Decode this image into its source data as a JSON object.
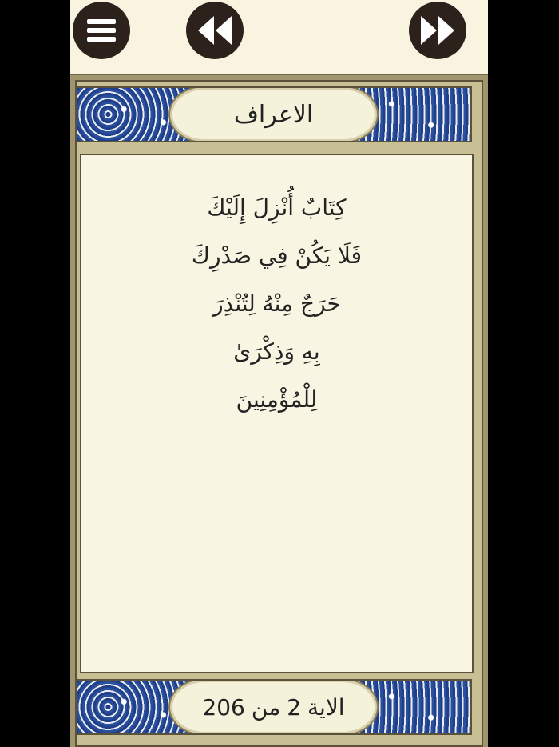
{
  "toolbar": {
    "menu_icon": "menu-icon",
    "prev_icon": "rewind-icon",
    "next_icon": "fast-forward-icon"
  },
  "header": {
    "surah_name": "الاعراف"
  },
  "verse": {
    "lines": [
      "كِتَابٌ أُنْزِلَ إِلَيْكَ",
      "فَلَا يَكُنْ فِي صَدْرِكَ",
      "حَرَجٌ مِنْهُ لِتُنْذِرَ",
      "بِهِ وَذِكْرَىٰ",
      "لِلْمُؤْمِنِينَ"
    ]
  },
  "footer": {
    "ayah_label": "الاية",
    "ayah_number": "2",
    "of_label": "من",
    "total_ayahs": "206"
  },
  "colors": {
    "button_bg": "#2d211c",
    "page_bg": "#f8f4df",
    "ornament_blue": "#2c4d96"
  }
}
